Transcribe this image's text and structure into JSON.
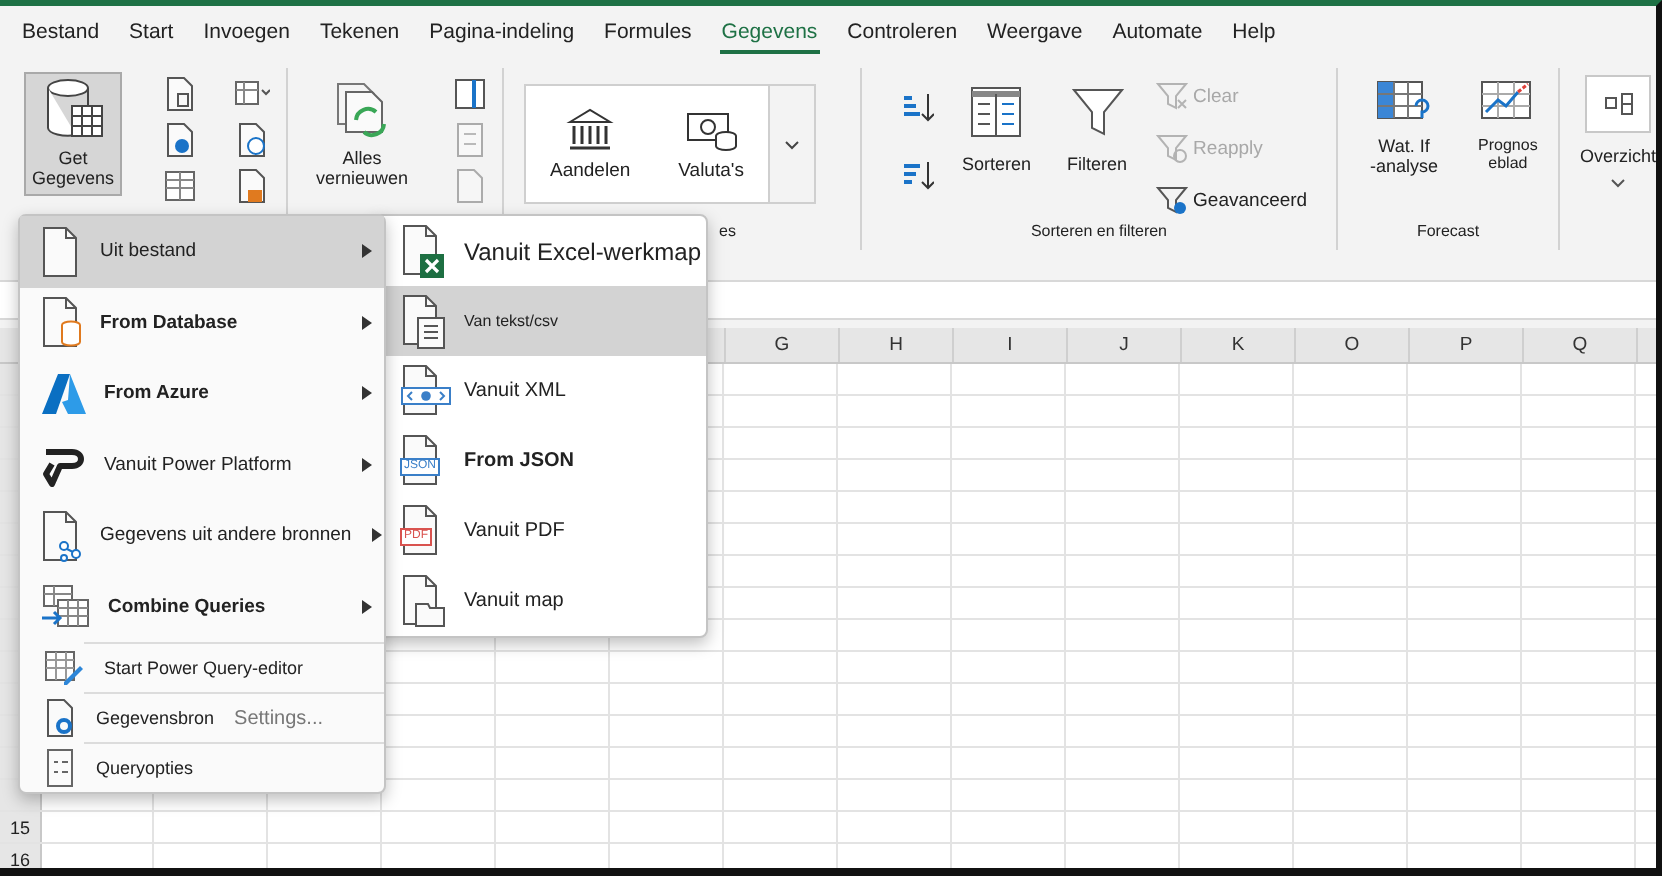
{
  "tabs": [
    {
      "label": "Bestand",
      "selected": false
    },
    {
      "label": "Start",
      "selected": false
    },
    {
      "label": "Invoegen",
      "selected": false
    },
    {
      "label": "Tekenen",
      "selected": false
    },
    {
      "label": "Pagina-indeling",
      "selected": false
    },
    {
      "label": "Formules",
      "selected": false
    },
    {
      "label": "Gegevens",
      "selected": true
    },
    {
      "label": "Controleren",
      "selected": false
    },
    {
      "label": "Weergave",
      "selected": false
    },
    {
      "label": "Automate",
      "selected": false
    },
    {
      "label": "Help",
      "selected": false
    }
  ],
  "ribbon": {
    "get_data": {
      "label": "Get\nGegevens",
      "selected": true
    },
    "refresh_all": {
      "label": "Alles\nvernieuwen"
    },
    "data_types": {
      "items": [
        "Aandelen",
        "Valuta's"
      ],
      "group_label": "es"
    },
    "sort_filter": {
      "sort": "Sorteren",
      "filter": "Filteren",
      "clear": {
        "label": "Clear",
        "disabled": true
      },
      "reapply": {
        "label": "Reapply",
        "disabled": true
      },
      "advanced": {
        "label": "Geavanceerd",
        "disabled": false
      },
      "group_label": "Sorteren en filteren"
    },
    "forecast": {
      "what_if": "Wat. If\n-analyse",
      "forecast_sheet": "Prognos\neblad",
      "group_label": "Forecast"
    },
    "outline": {
      "label": "Overzicht"
    }
  },
  "sheet": {
    "columns": [
      "G",
      "H",
      "I",
      "J",
      "K",
      "O",
      "P",
      "Q"
    ],
    "visible_row_numbers": [
      "15",
      "16"
    ]
  },
  "menu": {
    "items": [
      {
        "label": "Uit bestand",
        "bold": false,
        "submenu": true,
        "selected": true
      },
      {
        "label": "From Database",
        "bold": true,
        "submenu": true,
        "selected": false
      },
      {
        "label": "From Azure",
        "bold": true,
        "submenu": true,
        "selected": false
      },
      {
        "label": "Vanuit Power Platform",
        "bold": false,
        "submenu": true,
        "selected": false
      },
      {
        "label": "Gegevens uit andere bronnen",
        "bold": false,
        "submenu": true,
        "selected": false
      },
      {
        "label": "Combine Queries",
        "bold": true,
        "submenu": true,
        "selected": false
      }
    ],
    "footer": [
      {
        "label": "Start Power Query-editor"
      },
      {
        "label": "Gegevensbron",
        "note": "Settings..."
      },
      {
        "label": "Queryopties"
      }
    ]
  },
  "submenu": {
    "items": [
      {
        "label": "Vanuit Excel-werkmap",
        "bold": false,
        "selected": false
      },
      {
        "label": "Van tekst/csv",
        "bold": false,
        "selected": true
      },
      {
        "label": "Vanuit XML",
        "bold": false,
        "selected": false
      },
      {
        "label": "From JSON",
        "bold": true,
        "selected": false,
        "badge": "JSON"
      },
      {
        "label": "Vanuit PDF",
        "bold": false,
        "selected": false,
        "badge": "PDF"
      },
      {
        "label": "Vanuit map",
        "bold": false,
        "selected": false
      }
    ]
  }
}
